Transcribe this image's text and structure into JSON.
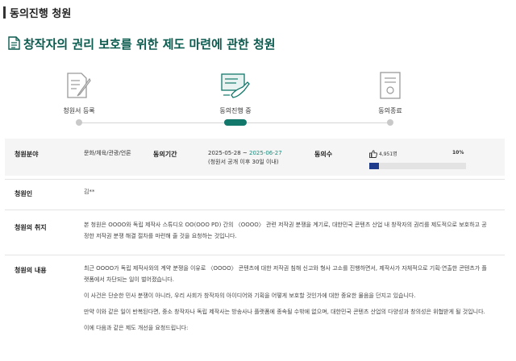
{
  "page_header": {
    "title": "동의진행 청원"
  },
  "petition": {
    "title": "창작자의 권리 보호를 위한 제도 마련에 관한 청원"
  },
  "steps": [
    {
      "label": "청원서 등록",
      "icon": "document-pen-icon",
      "active": false
    },
    {
      "label": "동의진행 중",
      "icon": "hand-signing-icon",
      "active": true
    },
    {
      "label": "동의종료",
      "icon": "certificate-icon",
      "active": false
    }
  ],
  "info": {
    "field_label": "청원분야",
    "field_value": "문화/체육/관광/언론",
    "period_label": "동의기간",
    "period_start": "2025-05-28",
    "period_sep": " ~ ",
    "period_end": "2025-06-27",
    "period_note": "(청원서 공개 이후 30일 이내)",
    "agree_label": "동의수",
    "agree_count": "4,951명",
    "agree_percent": "10%",
    "agree_progress": 0.1,
    "accent_color": "#1b8a7a",
    "bar_color": "#1f3b8c"
  },
  "petitioner": {
    "label": "청원인",
    "value": "김**"
  },
  "purpose": {
    "label": "청원의 취지",
    "text": "본 청원은 OOOO와 독립 제작사 스튜디오 OO(OOO PD) 간의 〈OOOO〉 관련 저작권 분쟁을 계기로, 대한민국 콘텐츠 산업 내 창작자의 권리를 제도적으로 보호하고 공정한 저작권 분쟁 해결 절차를 마련해 줄 것을 요청하는 것입니다."
  },
  "content": {
    "label": "청원의 내용",
    "paragraphs": [
      "최근 OOOO가 독립 제작사와의 계약 분쟁을 이유로 〈OOOO〉 콘텐츠에 대한 저작권 침해 신고와 형사 고소를 진행하면서, 제작사가 자체적으로 기획·연출한 콘텐츠가 플랫폼에서 차단되는 일이 벌어졌습니다.",
      "이 사건은 단순한 민사 분쟁이 아니라, 우리 사회가 창작자의 아이디어와 기획을 어떻게 보호할 것인가에 대한 중요한 물음을 던지고 있습니다.",
      "만약 이와 같은 일이 반복된다면, 중소 창작자나 독립 제작사는 방송사나 플랫폼에 종속될 수밖에 없으며, 대한민국 콘텐츠 산업의 다양성과 창의성은 위협받게 될 것입니다.",
      "이에 다음과 같은 제도 개선을 요청드립니다:"
    ]
  }
}
